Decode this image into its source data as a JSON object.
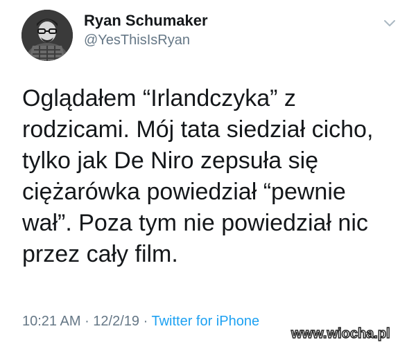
{
  "user": {
    "display_name": "Ryan Schumaker",
    "handle": "@YesThisIsRyan"
  },
  "tweet": {
    "text": "Oglądałem “Irlandczyka” z\nrodzicami. Mój tata siedział cicho,\ntylko jak De Niro zepsuła się\nciężarówka powiedział “pewnie\nwał”. Poza tym nie powiedział nic\nprzez cały film.",
    "time": "10:21 AM",
    "separator": " · ",
    "date": "12/2/19",
    "source": "Twitter for iPhone"
  },
  "icons": {
    "menu": "chevron-down-icon",
    "avatar": "avatar"
  },
  "watermark": "www.wiocha.pl",
  "colors": {
    "text": "#14171a",
    "secondary": "#657786",
    "link": "#1da1f2",
    "background": "#ffffff"
  }
}
